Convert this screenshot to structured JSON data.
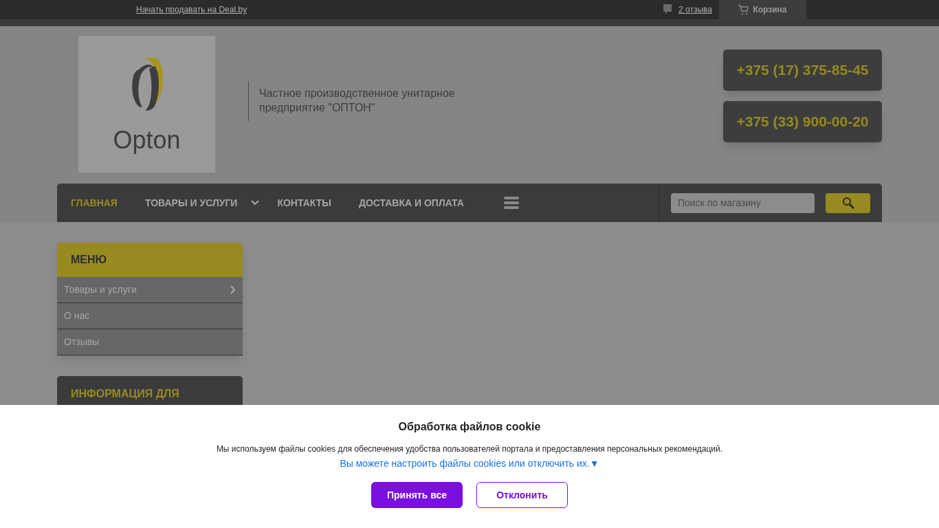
{
  "top_bar": {
    "sell_link": "Начать продавать на Deal.by",
    "reviews_link": "2 отзыва",
    "cart": "Корзина"
  },
  "header": {
    "logo_text": "Opton",
    "company_name": "Частное производственное унитарное предприятие \"ОПТОН\"",
    "phones": [
      "+375 (17) 375-85-45",
      "+375 (33) 900-00-20"
    ]
  },
  "nav": {
    "items": [
      {
        "label": "ГЛАВНАЯ",
        "selected": true,
        "has_dropdown": false
      },
      {
        "label": "ТОВАРЫ И УСЛУГИ",
        "selected": false,
        "has_dropdown": true
      },
      {
        "label": "КОНТАКТЫ",
        "selected": false,
        "has_dropdown": false
      },
      {
        "label": "ДОСТАВКА И ОПЛАТА",
        "selected": false,
        "has_dropdown": false
      }
    ],
    "search": {
      "placeholder": "Поиск по магазину"
    }
  },
  "sidebar": {
    "menu_title": "МЕНЮ",
    "items": [
      {
        "label": "Товары и услуги",
        "has_submenu": true
      },
      {
        "label": "О нас",
        "has_submenu": false
      },
      {
        "label": "Отзывы",
        "has_submenu": false
      }
    ],
    "info_title": "ИНФОРМАЦИЯ ДЛЯ"
  },
  "cookie_banner": {
    "title": "Обработка файлов cookie",
    "text": "Мы используем файлы cookies для обеспечения удобства пользователей портала и предоставления персональных рекомендаций.",
    "settings_link": "Вы можете настроить файлы cookies или отключить их.▼",
    "buttons": [
      {
        "label": "Принять все",
        "kind": "primary"
      },
      {
        "label": "Отклонить",
        "kind": "secondary"
      }
    ]
  }
}
